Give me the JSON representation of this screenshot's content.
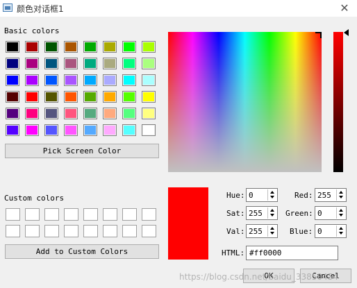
{
  "window": {
    "title": "颜色对话框1",
    "close_glyph": "✕"
  },
  "basic_colors": {
    "label": "Basic colors",
    "swatches": [
      "#000000",
      "#aa0000",
      "#005500",
      "#aa5500",
      "#00aa00",
      "#aaaa00",
      "#00ff00",
      "#aaff00",
      "#00007f",
      "#aa007f",
      "#00557f",
      "#aa557f",
      "#00aa7f",
      "#aaaa7f",
      "#00ff7f",
      "#aaff7f",
      "#0000ff",
      "#aa00ff",
      "#0055ff",
      "#aa55ff",
      "#00aaff",
      "#aaaaff",
      "#00ffff",
      "#aaffff",
      "#550000",
      "#ff0000",
      "#555500",
      "#ff5500",
      "#55aa00",
      "#ffaa00",
      "#55ff00",
      "#ffff00",
      "#55007f",
      "#ff007f",
      "#55557f",
      "#ff557f",
      "#55aa7f",
      "#ffaa7f",
      "#55ff7f",
      "#ffff7f",
      "#5500ff",
      "#ff00ff",
      "#5555ff",
      "#ff55ff",
      "#55aaff",
      "#ffaaff",
      "#55ffff",
      "#ffffff"
    ]
  },
  "pick_screen_color_label": "Pick Screen Color",
  "custom_colors": {
    "label": "Custom colors",
    "count": 16
  },
  "add_custom_label": "Add to Custom Colors",
  "current_color": "#ff0000",
  "fields": {
    "hue": {
      "label": "Hue:",
      "value": "0"
    },
    "sat": {
      "label": "Sat:",
      "value": "255"
    },
    "val": {
      "label": "Val:",
      "value": "255"
    },
    "red": {
      "label": "Red:",
      "value": "255"
    },
    "green": {
      "label": "Green:",
      "value": "0"
    },
    "blue": {
      "label": "Blue:",
      "value": "0"
    },
    "html": {
      "label": "HTML:",
      "value": "#ff0000"
    }
  },
  "ok_label": "OK",
  "cancel_label": "Cancel",
  "watermark": "https://blog.csdn.net/baidu_33850454"
}
